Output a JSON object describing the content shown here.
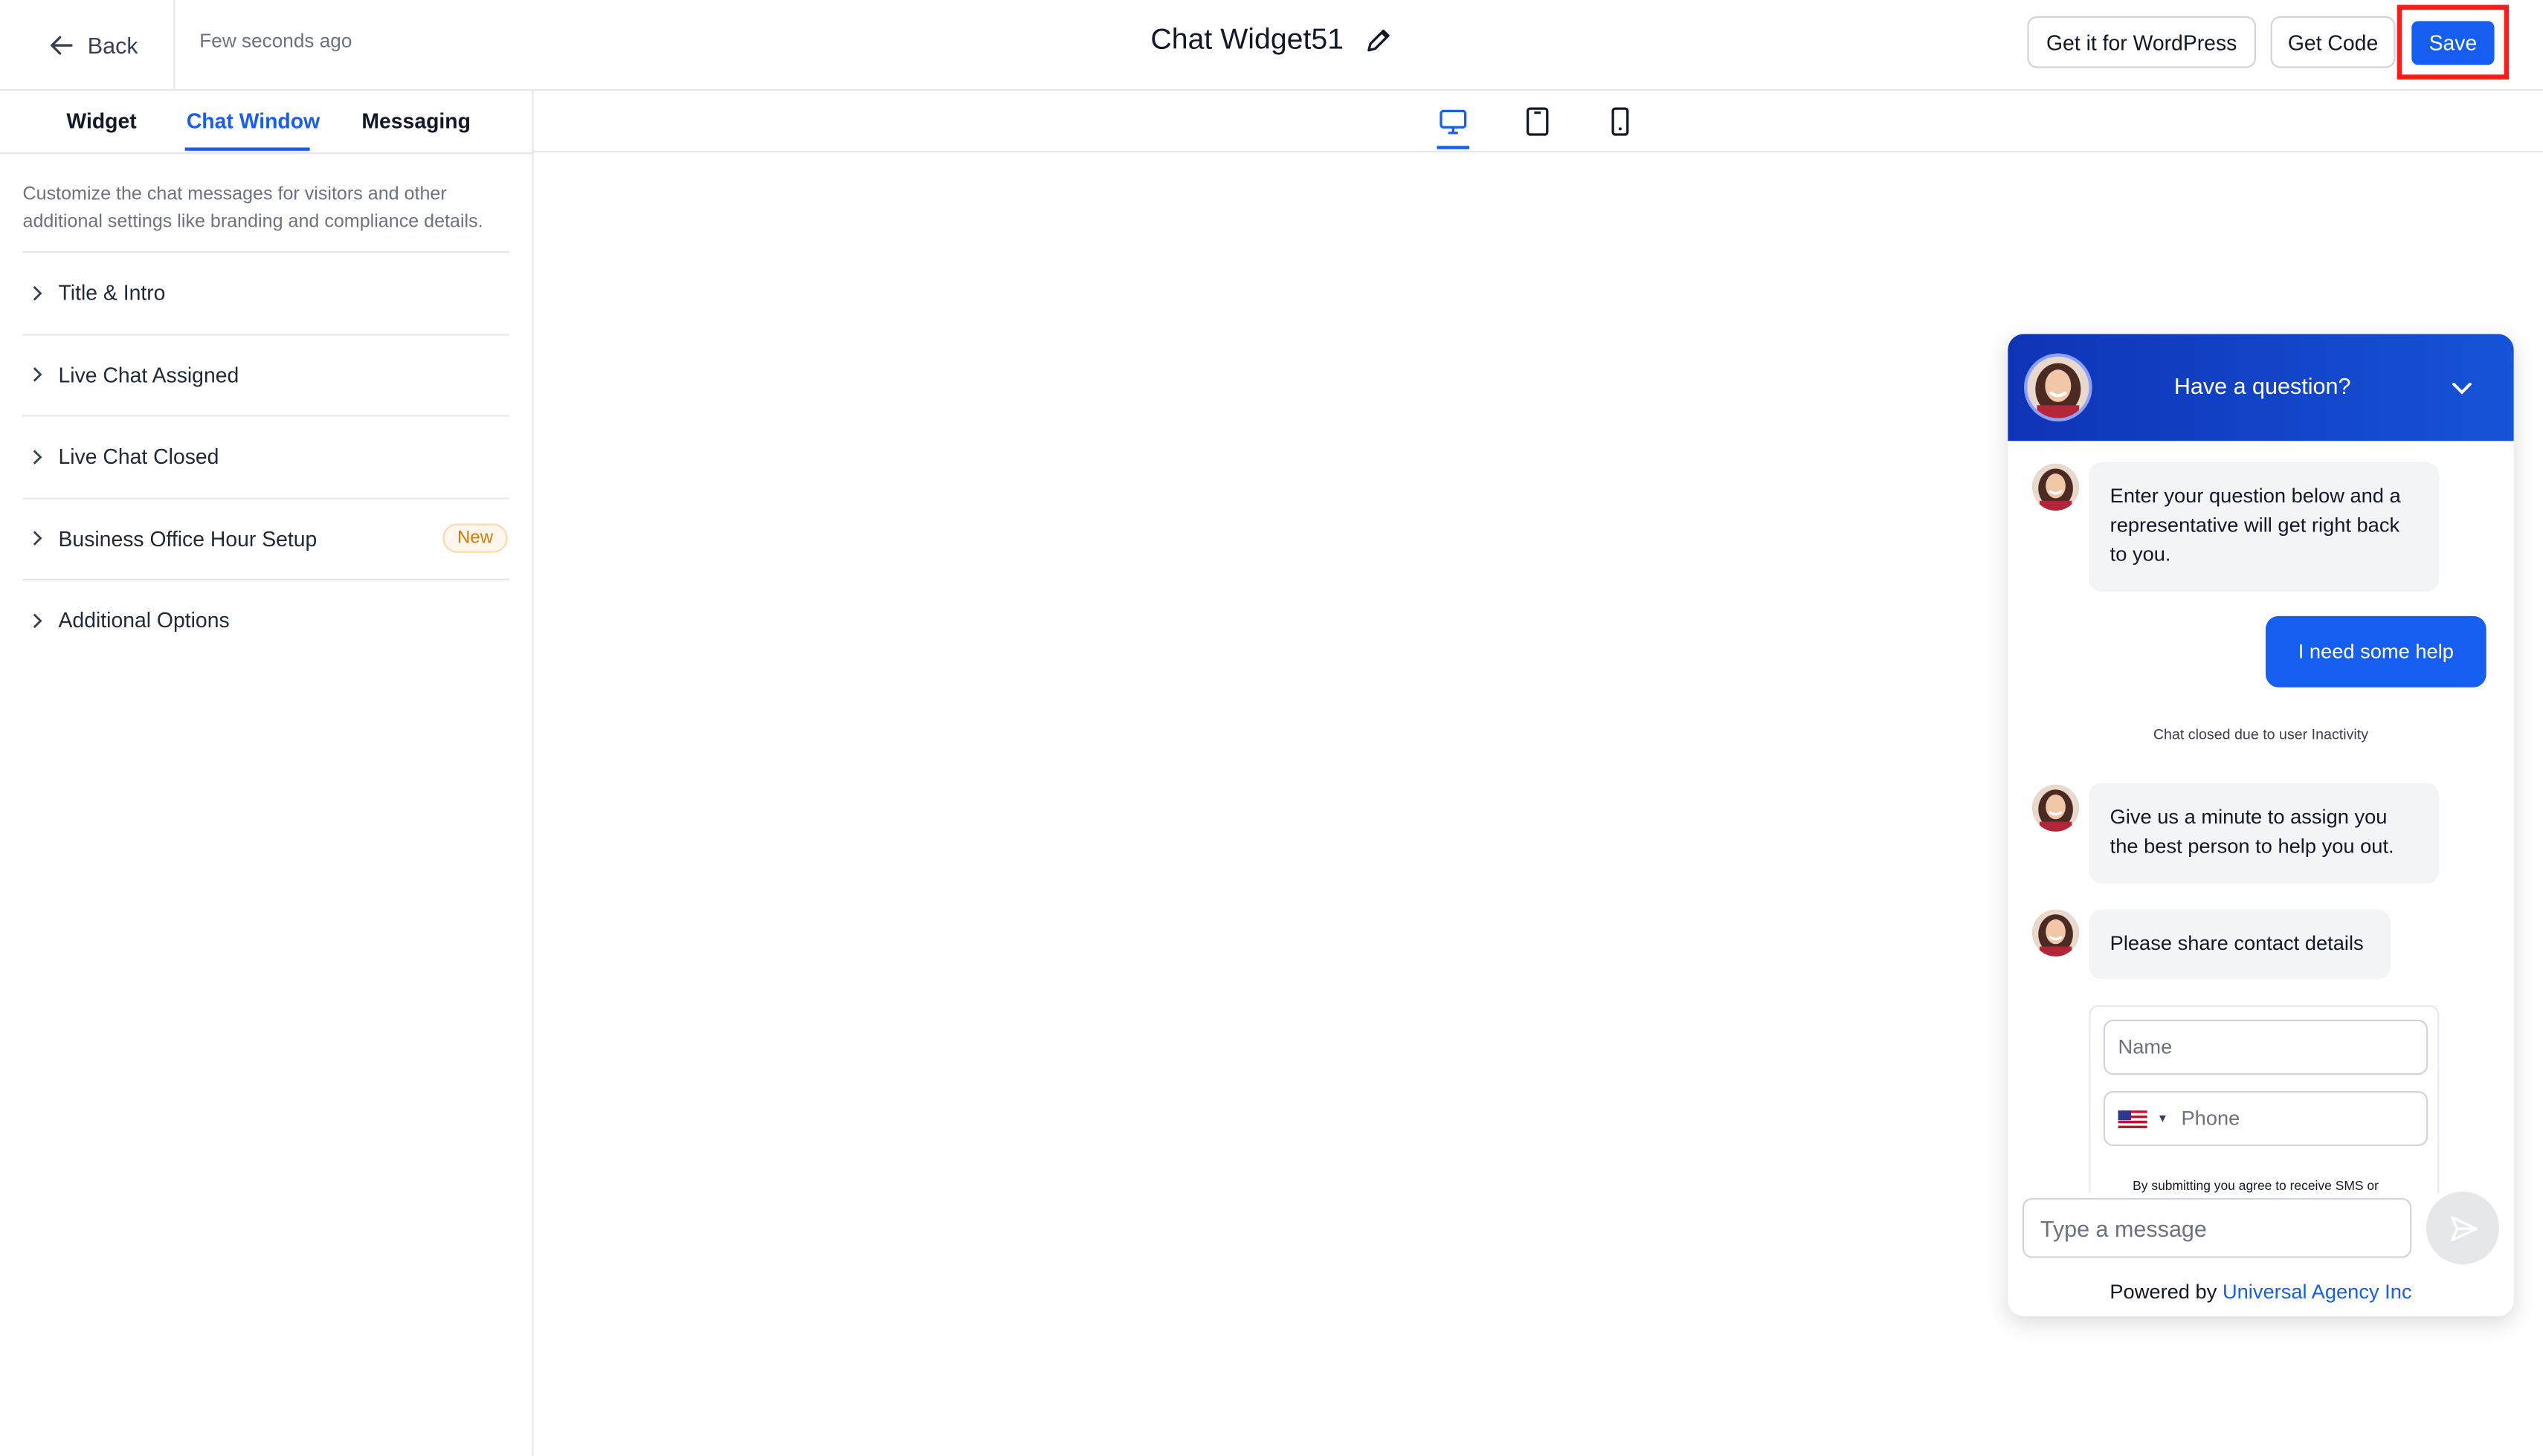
{
  "topbar": {
    "back_label": "Back",
    "saved_time": "Few seconds ago",
    "widget_title": "Chat Widget51",
    "wordpress_label": "Get it for WordPress",
    "get_code_label": "Get Code",
    "save_label": "Save"
  },
  "left_panel": {
    "tabs": [
      "Widget",
      "Chat Window",
      "Messaging"
    ],
    "active_tab": "Chat Window",
    "description": "Customize the chat messages for visitors and other additional settings like branding and compliance details.",
    "sections": [
      {
        "label": "Title & Intro"
      },
      {
        "label": "Live Chat Assigned"
      },
      {
        "label": "Live Chat Closed"
      },
      {
        "label": "Business Office Hour Setup",
        "badge": "New"
      },
      {
        "label": "Additional Options"
      }
    ]
  },
  "preview": {
    "devices": [
      "desktop-icon",
      "tablet-icon",
      "mobile-icon"
    ],
    "active_device": "desktop"
  },
  "chat": {
    "title": "Have a question?",
    "messages": {
      "intro": "Enter your question below and a representative will get right back to you.",
      "user": "I need some help",
      "system": "Chat closed due to user Inactivity",
      "assign": "Give us a minute to assign you the best person to help you out.",
      "contact": "Please share contact details"
    },
    "form": {
      "name_placeholder": "Name",
      "phone_placeholder": "Phone",
      "consent": "By submitting you agree to receive SMS or"
    },
    "input_placeholder": "Type a message",
    "powered_by": "Powered by",
    "agency": "Universal Agency Inc"
  },
  "colors": {
    "accent": "#155eef",
    "header_start": "#0f33b6",
    "header_end": "#1653d8",
    "badge": "#d97706",
    "highlight": "#ff1a1a"
  }
}
